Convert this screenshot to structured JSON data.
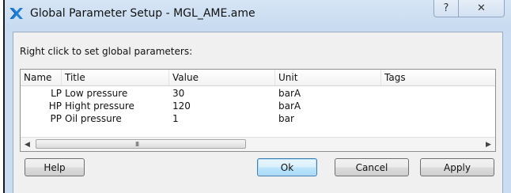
{
  "window": {
    "title": "Global Parameter Setup - MGL_AME.ame",
    "help_glyph": "?",
    "close_glyph": "✕",
    "icon": "x-cross-app-icon",
    "icon_color": "#1e7fd6"
  },
  "hint": "Right click to set global parameters:",
  "table": {
    "columns": [
      "Name",
      "Title",
      "Value",
      "Unit",
      "Tags"
    ],
    "rows": [
      {
        "name": "LP",
        "title": "Low pressure",
        "value": "30",
        "unit": "barA",
        "tags": ""
      },
      {
        "name": "HP",
        "title": "Hight pressure",
        "value": "120",
        "unit": "barA",
        "tags": ""
      },
      {
        "name": "PP",
        "title": "Oil pressure",
        "value": "1",
        "unit": "bar",
        "tags": ""
      }
    ]
  },
  "scrollbar": {
    "left_arrow": "◀",
    "right_arrow": "▶",
    "grip": "III"
  },
  "buttons": {
    "help": "Help",
    "ok": "Ok",
    "cancel": "Cancel",
    "apply": "Apply"
  }
}
